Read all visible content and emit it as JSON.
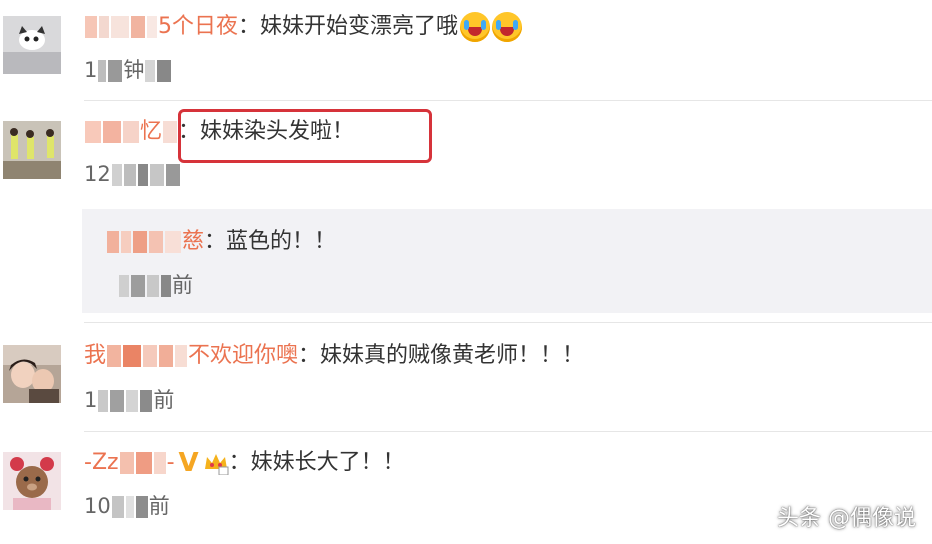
{
  "comments": [
    {
      "name_visible": "5个日夜",
      "separator": "：",
      "text": "妹妹开始变漂亮了哦",
      "emoji": [
        "crying-laughing-emoji",
        "crying-laughing-emoji"
      ],
      "time_visible": [
        "1",
        "钟"
      ]
    },
    {
      "name_visible": "忆",
      "separator": "：",
      "text": "妹妹染头发啦！",
      "time_visible": [
        "12"
      ],
      "reply": {
        "name_visible": "慈",
        "separator": "：",
        "text": "蓝色的！！",
        "time_visible": [
          "前"
        ]
      }
    },
    {
      "name_visible_prefix": "我",
      "name_visible": "不欢迎你噢",
      "separator": "：",
      "text": "妹妹真的贼像黄老师！！！",
      "time_visible": [
        "1",
        "前"
      ]
    },
    {
      "name_visible_prefix": "-Zz",
      "name_visible_suffix": "-",
      "badges": [
        "vip-v-badge",
        "crown-badge"
      ],
      "separator": "：",
      "text": "妹妹长大了！！",
      "time_visible": [
        "10",
        "前"
      ]
    }
  ],
  "watermark": "头条 @偶像说",
  "colors": {
    "name": "#eb7350",
    "text": "#333333",
    "meta": "#666666",
    "reply_bg": "#f2f2f5",
    "highlight": "#d6333a"
  }
}
